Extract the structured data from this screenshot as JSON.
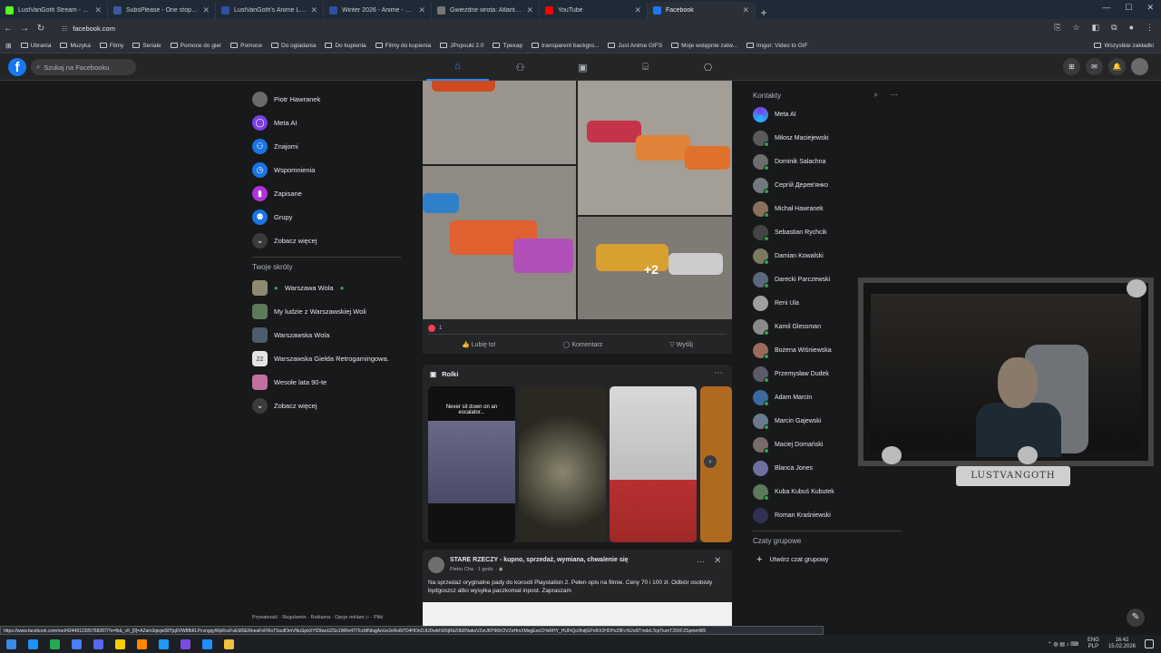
{
  "browser": {
    "tabs": [
      {
        "title": "LustVanGoth Stream - Watch Li",
        "color": "#53fc18"
      },
      {
        "title": "SubsPlease - One stop shop fo",
        "color": "#3b5998"
      },
      {
        "title": "LustVanGoth's Anime List - My",
        "color": "#2e51a2"
      },
      {
        "title": "Winter 2026 - Anime - MyAnim",
        "color": "#2e51a2"
      },
      {
        "title": "Gwiezdne wrota: Atlantyda / St",
        "color": "#777777"
      },
      {
        "title": "YouTube",
        "color": "#ff0000"
      },
      {
        "title": "Facebook",
        "color": "#1877f2"
      }
    ],
    "new_tab": "+",
    "url": "facebook.com",
    "bookmarks": [
      "Ubrania",
      "Muzyka",
      "Filmy",
      "Seriale",
      "Pomoce do gier",
      "Pomoce",
      "Do ogladania",
      "Do kupienia",
      "Filmy do kupienia",
      "JPopsuki 2.0",
      "Tpexap",
      "transparent backgro...",
      "Just Anime GIFS",
      "Moje wstępnie zatw...",
      "Imgur: Video to GIF"
    ],
    "bookmarks_all": "Wszystkie zakładki",
    "status_url": "https://www.facebook.com/reel/4244912305768287/?s=fb&_cft_[0]=AZam3qisjw58Tjq6VW8fbKLPcvngqyWpRozFuEMSERneaFnFt5oTSsufOmVNuSpbXYf29wsU2Ss1WRx4TITccMNbqjAnUe2eRo8i7O4HOnOJUDwkFiD6jRkZ0bDNabsVZeUKP96KOVZeHrsXMegEsxCHsRHY_HUFtQo3hdjGPoRX2HDPsZ8Fc%2x6lTmdeLTcpTiumT29XFZSpmmW5"
  },
  "facebook": {
    "logo": "f",
    "search_placeholder": "Szukaj na Facebooku",
    "nav": [
      "home",
      "friends",
      "watch",
      "marketplace",
      "gaming"
    ],
    "left": {
      "items": [
        {
          "label": "Piotr Hawranek",
          "color": "#6a6a6a",
          "icon": "avatar"
        },
        {
          "label": "Meta AI",
          "color": "#7b3fe4",
          "icon": "meta-ai-icon"
        },
        {
          "label": "Znajomi",
          "color": "#1b74e4",
          "icon": "friends-icon"
        },
        {
          "label": "Wspomnienia",
          "color": "#1b74e4",
          "icon": "memories-icon"
        },
        {
          "label": "Zapisane",
          "color": "#b033d8",
          "icon": "saved-icon"
        },
        {
          "label": "Grupy",
          "color": "#1b74e4",
          "icon": "groups-icon"
        },
        {
          "label": "Zobacz więcej",
          "color": "#3a3b3c",
          "icon": "chevron-down-icon"
        }
      ],
      "shortcuts_title": "Twoje skróty",
      "shortcuts": [
        {
          "label": "Warszawa Wola",
          "color": "#8e8a70"
        },
        {
          "label": "My ludzie z Warszawskiej Woli",
          "color": "#5c7a5a"
        },
        {
          "label": "Warszawska Wola",
          "color": "#4d5d6d"
        },
        {
          "label": "Warszawska Giełda Retrogamingowa.",
          "color": "#e4e4e4"
        },
        {
          "label": "Wesołe lata 90-te",
          "color": "#c070a0"
        },
        {
          "label": "Zobacz więcej",
          "color": "#3a3b3c"
        }
      ],
      "shortcut_date": "22",
      "footer": "Prywatność · Regulamin · Reklama · Opcje reklam ▷ · Pliki"
    },
    "post": {
      "more_photos": "+2",
      "reactions": "1",
      "like": "Lubię to!",
      "comment": "Komentarz",
      "share": "Wyślij"
    },
    "reels": {
      "title": "Rolki",
      "first_caption": "Never sit down on an escalator..."
    },
    "post2": {
      "title": "STARE RZECZY - kupno, sprzedaż, wymiana, chwalenie się",
      "meta": "Pietru Cha · 1 godz. · ◉",
      "text": "Na sprzedaż oryginalne pady do konsoli Playstation 2. Pełen opis na filmie.  Ceny 70 i 100 zł. Odbiór osobisty bydgoszcz albo wysyłka paczkomat inpost.  Zapraszam"
    },
    "contacts": {
      "title": "Kontakty",
      "people": [
        {
          "name": "Meta AI",
          "color": "#7b3fe4",
          "online": false
        },
        {
          "name": "Miłosz Maciejewski",
          "color": "#5a5a5a",
          "online": true
        },
        {
          "name": "Dominik Salachna",
          "color": "#6d6d6d",
          "online": true
        },
        {
          "name": "Сергій Дерев'янко",
          "color": "#707880",
          "online": true
        },
        {
          "name": "Michał Hawranek",
          "color": "#8a6f5a",
          "online": true
        },
        {
          "name": "Sebastian Rychcik",
          "color": "#444444",
          "online": true
        },
        {
          "name": "Damian Kowalski",
          "color": "#7a7a60",
          "online": true
        },
        {
          "name": "Darecki Parczewski",
          "color": "#5a6a7a",
          "online": true
        },
        {
          "name": "Reni Ula",
          "color": "#a0a0a0",
          "online": false
        },
        {
          "name": "Kamil Glessman",
          "color": "#8a8a8a",
          "online": true
        },
        {
          "name": "Bożena Wiśniewska",
          "color": "#9a6a5a",
          "online": true
        },
        {
          "name": "Przemysław Dudek",
          "color": "#5a5a6a",
          "online": true
        },
        {
          "name": "Adam Marcin",
          "color": "#3a6aa0",
          "online": true
        },
        {
          "name": "Marcin Gajewski",
          "color": "#6a7a8a",
          "online": true
        },
        {
          "name": "Maciej Domański",
          "color": "#7a6a6a",
          "online": true
        },
        {
          "name": "Blanca Jones",
          "color": "#7070a0",
          "online": false
        },
        {
          "name": "Kuba Kubuś Kubutek",
          "color": "#5a7a5a",
          "online": true
        },
        {
          "name": "Roman Kraśniewski",
          "color": "#303050",
          "online": false
        }
      ],
      "groups_title": "Czaty grupowe",
      "create_group": "Utwórz czat grupowy"
    }
  },
  "webcam": {
    "label": "LUSTVANGOTH"
  },
  "taskbar": {
    "apps": [
      "#1e90ff",
      "#22aa55",
      "#4a80ff",
      "#5865f2",
      "#ffcc00",
      "#ff8800",
      "#1b9cfc",
      "#7a4ae2",
      "#1e90ff",
      "#f0c040"
    ],
    "lang": "ENG",
    "lang2": "PLP",
    "time": "16:42",
    "date": "15.02.2026"
  }
}
